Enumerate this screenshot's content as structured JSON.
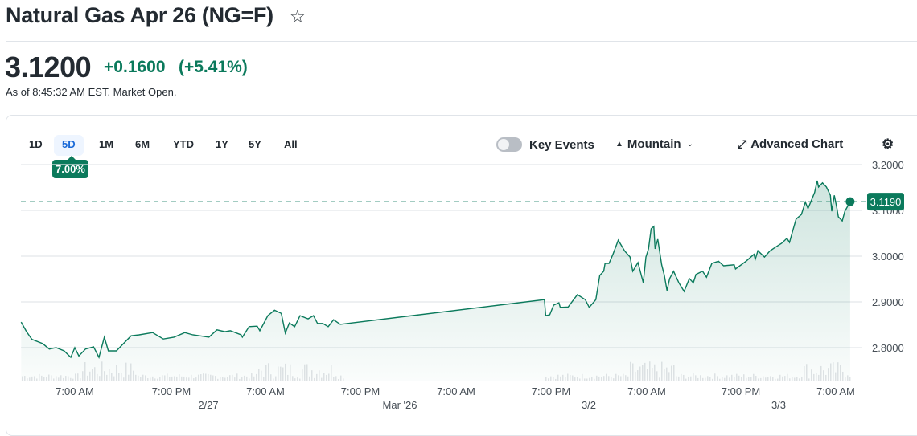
{
  "header": {
    "title": "Natural Gas Apr 26 (NG=F)",
    "star_icon": "☆"
  },
  "quote": {
    "price": "3.1200",
    "change": "+0.1600",
    "percent": "(+5.41%)",
    "as_of": "As of 8:45:32 AM EST. Market Open.",
    "positive_color": "#0b7a5c"
  },
  "toolbar": {
    "ranges": [
      "1D",
      "5D",
      "1M",
      "6M",
      "YTD",
      "1Y",
      "5Y",
      "All"
    ],
    "active_range": "5D",
    "range_change": "7.00%",
    "key_events": "Key Events",
    "key_events_on": false,
    "chart_type": "Mountain",
    "advanced": "Advanced Chart",
    "settings_icon": "gear-icon"
  },
  "chart_data": {
    "type": "area",
    "ylim": [
      2.75,
      3.2
    ],
    "yticks": [
      "3.2000",
      "3.1000",
      "3.0000",
      "2.9000",
      "2.8000"
    ],
    "xticks": [
      "7:00 AM",
      "7:00 PM",
      "7:00 AM",
      "7:00 PM",
      "7:00 AM",
      "7:00 PM",
      "7:00 AM",
      "7:00 AM"
    ],
    "xticks_all": [
      "7:00 AM",
      "7:00 PM",
      "7:00 AM",
      "7:00 PM",
      "7:00 AM",
      "7:00 PM",
      "7:00 AM",
      "7:00 PM",
      "7:00 AM"
    ],
    "date_labels": [
      "2/27",
      "Mar '26",
      "3/2",
      "3/3"
    ],
    "current_label": "3.1190",
    "current_value": 3.119,
    "line_color": "#0b7a5c",
    "grid": true,
    "points": [
      [
        "2/26 00:20",
        2.856
      ],
      [
        "2/26 01:00",
        2.835
      ],
      [
        "2/26 01:40",
        2.818
      ],
      [
        "2/26 03:00",
        2.809
      ],
      [
        "2/26 03:50",
        2.797
      ],
      [
        "2/26 04:40",
        2.8
      ],
      [
        "2/26 05:40",
        2.793
      ],
      [
        "2/26 06:30",
        2.779
      ],
      [
        "2/26 07:00",
        2.8
      ],
      [
        "2/26 07:30",
        2.782
      ],
      [
        "2/26 08:20",
        2.797
      ],
      [
        "2/26 09:20",
        2.802
      ],
      [
        "2/26 10:00",
        2.779
      ],
      [
        "2/26 10:40",
        2.823
      ],
      [
        "2/26 11:10",
        2.793
      ],
      [
        "2/26 12:10",
        2.793
      ],
      [
        "2/26 13:20",
        2.814
      ],
      [
        "2/26 14:00",
        2.826
      ],
      [
        "2/26 15:00",
        2.828
      ],
      [
        "2/26 16:40",
        2.833
      ],
      [
        "2/26 18:00",
        2.819
      ],
      [
        "2/26 19:20",
        2.823
      ],
      [
        "2/26 20:40",
        2.833
      ],
      [
        "2/26 21:40",
        2.828
      ],
      [
        "2/26 23:40",
        2.823
      ],
      [
        "2/27 00:40",
        2.839
      ],
      [
        "2/27 01:40",
        2.835
      ],
      [
        "2/27 02:20",
        2.837
      ],
      [
        "2/27 03:40",
        2.828
      ],
      [
        "2/27 03:50",
        2.823
      ],
      [
        "2/27 04:40",
        2.846
      ],
      [
        "2/27 05:40",
        2.847
      ],
      [
        "2/27 06:00",
        2.837
      ],
      [
        "2/27 07:00",
        2.87
      ],
      [
        "2/27 07:50",
        2.882
      ],
      [
        "2/27 08:40",
        2.875
      ],
      [
        "2/27 09:10",
        2.832
      ],
      [
        "2/27 09:40",
        2.854
      ],
      [
        "2/27 10:20",
        2.846
      ],
      [
        "2/27 11:00",
        2.87
      ],
      [
        "2/27 12:00",
        2.863
      ],
      [
        "2/27 12:40",
        2.87
      ],
      [
        "2/27 13:10",
        2.853
      ],
      [
        "2/27 13:50",
        2.853
      ],
      [
        "2/27 14:30",
        2.846
      ],
      [
        "2/27 15:10",
        2.861
      ],
      [
        "2/27 16:00",
        2.851
      ],
      [
        "3/1 18:10",
        2.905
      ],
      [
        "3/1 18:20",
        2.87
      ],
      [
        "3/1 18:50",
        2.872
      ],
      [
        "3/1 19:20",
        2.893
      ],
      [
        "3/1 20:00",
        2.898
      ],
      [
        "3/1 20:10",
        2.888
      ],
      [
        "3/1 21:10",
        2.889
      ],
      [
        "3/1 22:20",
        2.916
      ],
      [
        "3/1 23:20",
        2.905
      ],
      [
        "3/1 23:50",
        2.888
      ],
      [
        "3/2 00:40",
        2.905
      ],
      [
        "3/2 01:10",
        2.958
      ],
      [
        "3/2 01:40",
        2.967
      ],
      [
        "3/2 01:50",
        2.984
      ],
      [
        "3/2 02:20",
        2.984
      ],
      [
        "3/2 02:50",
        3.004
      ],
      [
        "3/2 03:30",
        3.035
      ],
      [
        "3/2 04:20",
        3.011
      ],
      [
        "3/2 05:00",
        2.998
      ],
      [
        "3/2 05:20",
        2.967
      ],
      [
        "3/2 06:00",
        2.986
      ],
      [
        "3/2 06:40",
        2.942
      ],
      [
        "3/2 07:00",
        2.998
      ],
      [
        "3/2 07:20",
        3.016
      ],
      [
        "3/2 07:40",
        3.06
      ],
      [
        "3/2 08:00",
        3.065
      ],
      [
        "3/2 08:10",
        3.016
      ],
      [
        "3/2 08:30",
        3.037
      ],
      [
        "3/2 09:00",
        2.981
      ],
      [
        "3/2 09:20",
        2.958
      ],
      [
        "3/2 09:40",
        2.925
      ],
      [
        "3/2 10:00",
        2.951
      ],
      [
        "3/2 10:30",
        2.967
      ],
      [
        "3/2 11:10",
        2.942
      ],
      [
        "3/2 11:50",
        2.923
      ],
      [
        "3/2 12:30",
        2.951
      ],
      [
        "3/2 13:00",
        2.942
      ],
      [
        "3/2 13:20",
        2.96
      ],
      [
        "3/2 14:10",
        2.967
      ],
      [
        "3/2 14:40",
        2.954
      ],
      [
        "3/2 15:20",
        2.984
      ],
      [
        "3/2 16:10",
        2.989
      ],
      [
        "3/2 16:50",
        2.979
      ],
      [
        "3/2 18:10",
        2.981
      ],
      [
        "3/2 18:20",
        2.972
      ],
      [
        "3/2 19:40",
        2.989
      ],
      [
        "3/2 20:40",
        3.004
      ],
      [
        "3/2 20:50",
        2.993
      ],
      [
        "3/2 21:10",
        3.012
      ],
      [
        "3/2 22:00",
        2.998
      ],
      [
        "3/2 22:40",
        3.011
      ],
      [
        "3/2 23:20",
        3.019
      ],
      [
        "3/3 00:10",
        3.028
      ],
      [
        "3/3 00:50",
        3.039
      ],
      [
        "3/3 01:10",
        3.03
      ],
      [
        "3/3 01:30",
        3.051
      ],
      [
        "3/3 02:00",
        3.081
      ],
      [
        "3/3 02:40",
        3.091
      ],
      [
        "3/3 03:10",
        3.118
      ],
      [
        "3/3 03:30",
        3.104
      ],
      [
        "3/3 03:50",
        3.118
      ],
      [
        "3/3 04:20",
        3.139
      ],
      [
        "3/3 04:40",
        3.165
      ],
      [
        "3/3 04:50",
        3.151
      ],
      [
        "3/3 05:20",
        3.16
      ],
      [
        "3/3 05:50",
        3.151
      ],
      [
        "3/3 06:20",
        3.133
      ],
      [
        "3/3 06:30",
        3.098
      ],
      [
        "3/3 06:50",
        3.133
      ],
      [
        "3/3 07:10",
        3.104
      ],
      [
        "3/3 07:20",
        3.086
      ],
      [
        "3/3 07:50",
        3.077
      ],
      [
        "3/3 08:10",
        3.098
      ],
      [
        "3/3 08:50",
        3.119
      ]
    ]
  }
}
